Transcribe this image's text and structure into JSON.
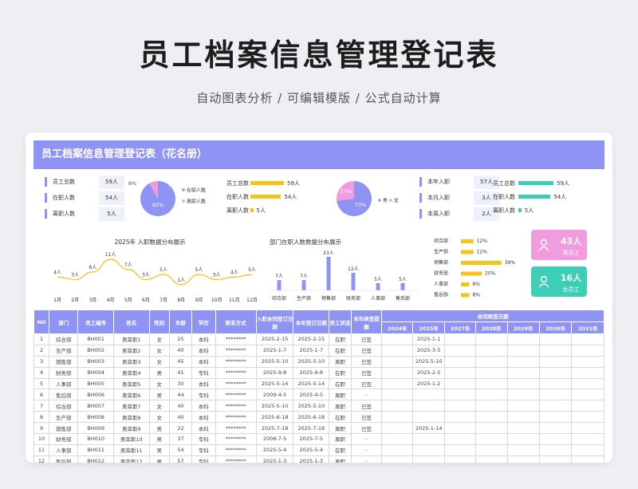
{
  "page": {
    "title": "员工档案信息管理登记表",
    "subtitle": "自动图表分析  /  可编辑模版  /  公式自动计算"
  },
  "sheet": {
    "header": "员工档案信息管理登记表（花名册）"
  },
  "stats1": [
    {
      "label": "员工总数",
      "value": "59人"
    },
    {
      "label": "在职人数",
      "value": "54人"
    },
    {
      "label": "离职人数",
      "value": "5人"
    }
  ],
  "pie1": {
    "labels": [
      "在职人数",
      "离职人数"
    ],
    "pct_labels": [
      "92%",
      "8%"
    ],
    "values": [
      92,
      8
    ],
    "colors": [
      "#8f93f3",
      "#f29ce0"
    ]
  },
  "hbars1": [
    {
      "label": "员工总数",
      "value": 59,
      "text": "59人"
    },
    {
      "label": "在职人数",
      "value": 54,
      "text": "54人"
    },
    {
      "label": "离职人数",
      "value": 5,
      "text": "5人"
    }
  ],
  "pie2": {
    "labels": [
      "男",
      "女"
    ],
    "pct_labels": [
      "73%",
      "27%"
    ],
    "values": [
      73,
      27
    ],
    "colors": [
      "#8f93f3",
      "#f29ce0"
    ]
  },
  "stats2": [
    {
      "label": "本年入职",
      "value": "57人"
    },
    {
      "label": "本月入职",
      "value": "3人"
    },
    {
      "label": "本周入职",
      "value": "2人"
    }
  ],
  "hbars2": [
    {
      "label": "员工总数",
      "value": 59,
      "text": "59人"
    },
    {
      "label": "在职人数",
      "value": 54,
      "text": "54人"
    },
    {
      "label": "离职人数",
      "value": 5,
      "text": "5人"
    }
  ],
  "colors": {
    "accent": "#8f93f3",
    "pink": "#f29ce0",
    "yellow": "#f7c21a",
    "teal": "#3ecdb5"
  },
  "gender_cards": [
    {
      "count": "43人",
      "label": "男员工",
      "color": "#f29ce0",
      "icon": "male-user-icon"
    },
    {
      "count": "16人",
      "label": "女员工",
      "color": "#3ecdb5",
      "icon": "female-user-icon"
    }
  ],
  "chart_data": [
    {
      "type": "line",
      "title": "2025年 入职数据分布展示",
      "categories": [
        "1月",
        "2月",
        "3月",
        "4月",
        "5月",
        "6月",
        "7月",
        "8月",
        "9月",
        "10月",
        "11月",
        "12月"
      ],
      "values": [
        4,
        3,
        6,
        11,
        7,
        3,
        5,
        1,
        5,
        3,
        4,
        5
      ],
      "labels": [
        "4人",
        "3人",
        "6人",
        "11人",
        "7人",
        "3人",
        "5人",
        "1人",
        "5人",
        "3人",
        "4人",
        "5人"
      ],
      "color": "#f7c21a"
    },
    {
      "type": "bar",
      "title": "部门在职人数数据分布展示",
      "categories": [
        "综合部",
        "生产部",
        "销售部",
        "财务部",
        "人事部",
        "售后部"
      ],
      "values": [
        7,
        7,
        23,
        12,
        5,
        5
      ],
      "labels": [
        "7人",
        "7人",
        "23人",
        "12人",
        "5人",
        "5人"
      ],
      "color": "#8f93f3"
    },
    {
      "type": "bar",
      "orientation": "horizontal",
      "categories": [
        "综合部",
        "生产部",
        "销售部",
        "财务部",
        "人事部",
        "售后部"
      ],
      "values": [
        12,
        12,
        39,
        20,
        8,
        8
      ],
      "labels": [
        "12%",
        "12%",
        "39%",
        "20%",
        "8%",
        "8%"
      ],
      "color": "#f7c21a"
    }
  ],
  "table": {
    "headers": [
      "NO",
      "部门",
      "员工编号",
      "姓名",
      "性别",
      "年龄",
      "学历",
      "联系方式",
      "入职合同签订日期",
      "本年签订日期",
      "员工状态",
      "本年续签提醒"
    ],
    "contract_header": "合同续签日期",
    "years": [
      "2024年",
      "2025年",
      "2027年",
      "2028年",
      "2029年",
      "2030年",
      "2031年"
    ],
    "rows": [
      [
        "1",
        "综合部",
        "BH001",
        "奥菲斯1",
        "女",
        "25",
        "本科",
        "********",
        "2025-2-15",
        "2025-2-15",
        "在职",
        "已签",
        "",
        "2025-1-1"
      ],
      [
        "2",
        "生产部",
        "BH002",
        "奥菲斯2",
        "女",
        "40",
        "本科",
        "********",
        "2025-1-7",
        "2025-1-7",
        "在职",
        "已签",
        "",
        "2025-3-5"
      ],
      [
        "3",
        "销售部",
        "BH003",
        "奥菲斯3",
        "女",
        "45",
        "本科",
        "********",
        "2025-5-10",
        "2025-5-10",
        "离职",
        "已签",
        "",
        "2025-5-10"
      ],
      [
        "4",
        "财务部",
        "BH004",
        "奥菲斯4",
        "男",
        "41",
        "专科",
        "********",
        "2025-9-8",
        "2025-9-8",
        "在职",
        "已签",
        "",
        "2025-2-5"
      ],
      [
        "5",
        "人事部",
        "BH005",
        "奥菲斯5",
        "女",
        "30",
        "本科",
        "********",
        "2025-5-14",
        "2025-5-14",
        "在职",
        "已签",
        "",
        "2025-1-2"
      ],
      [
        "6",
        "售后部",
        "BH006",
        "奥菲斯6",
        "男",
        "44",
        "专科",
        "********",
        "2009-4-5",
        "2025-4-5",
        "离职",
        "-",
        "",
        ""
      ],
      [
        "7",
        "综合部",
        "BH007",
        "奥菲斯7",
        "女",
        "40",
        "本科",
        "********",
        "2025-5-10",
        "2025-5-10",
        "离职",
        "已签",
        "",
        ""
      ],
      [
        "8",
        "生产部",
        "BH008",
        "奥菲斯8",
        "女",
        "40",
        "本科",
        "********",
        "2025-6-18",
        "2025-6-18",
        "在职",
        "已签",
        "",
        ""
      ],
      [
        "9",
        "销售部",
        "BH009",
        "奥菲斯9",
        "男",
        "22",
        "本科",
        "********",
        "2025-7-18",
        "2025-7-18",
        "离职",
        "已签",
        "",
        "2025-1-14"
      ],
      [
        "10",
        "财务部",
        "BH010",
        "奥菲斯10",
        "男",
        "37",
        "专科",
        "********",
        "2008-7-5",
        "2025-7-5",
        "离职",
        "-",
        "",
        ""
      ],
      [
        "11",
        "人事部",
        "BH011",
        "奥菲斯11",
        "男",
        "54",
        "专科",
        "********",
        "2025-5-4",
        "2025-5-4",
        "在职",
        "-",
        "",
        ""
      ],
      [
        "12",
        "售后部",
        "BH012",
        "奥菲斯12",
        "男",
        "57",
        "专科",
        "********",
        "2025-1-3",
        "2025-1-3",
        "离职",
        "-",
        "",
        ""
      ]
    ]
  }
}
